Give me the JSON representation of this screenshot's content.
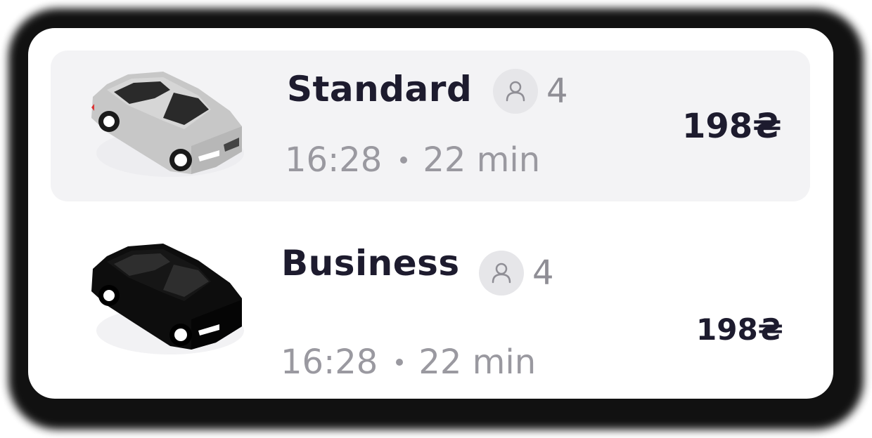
{
  "options": [
    {
      "name": "Standard",
      "seats": "4",
      "time": "16:28",
      "duration": "22 min",
      "price": "198₴",
      "selected": true,
      "car_color": "#c8c8c8",
      "car_icon": "silver-sedan"
    },
    {
      "name": "Business",
      "seats": "4",
      "time": "16:28",
      "duration": "22 min",
      "price": "198₴",
      "selected": false,
      "car_color": "#111111",
      "car_icon": "black-sedan"
    }
  ],
  "colors": {
    "selected_background": "#f3f3f5",
    "text_dark": "#1d1b2e",
    "text_muted": "#9a99a0",
    "seat_badge": "#e6e6e9"
  }
}
